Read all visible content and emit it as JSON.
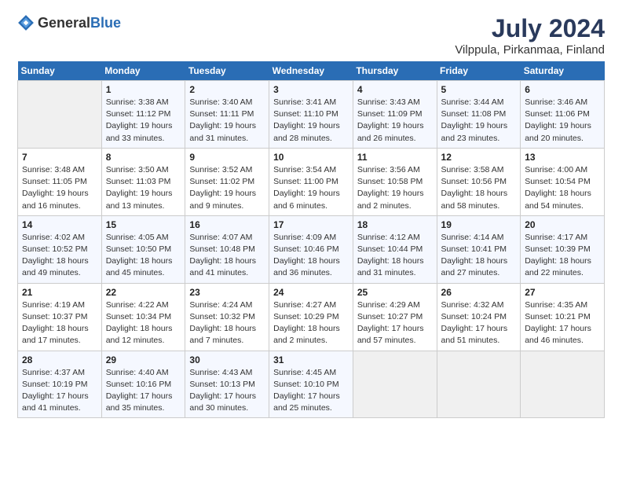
{
  "logo": {
    "general": "General",
    "blue": "Blue"
  },
  "title": "July 2024",
  "subtitle": "Vilppula, Pirkanmaa, Finland",
  "headers": [
    "Sunday",
    "Monday",
    "Tuesday",
    "Wednesday",
    "Thursday",
    "Friday",
    "Saturday"
  ],
  "weeks": [
    [
      {
        "num": "",
        "detail": ""
      },
      {
        "num": "1",
        "detail": "Sunrise: 3:38 AM\nSunset: 11:12 PM\nDaylight: 19 hours\nand 33 minutes."
      },
      {
        "num": "2",
        "detail": "Sunrise: 3:40 AM\nSunset: 11:11 PM\nDaylight: 19 hours\nand 31 minutes."
      },
      {
        "num": "3",
        "detail": "Sunrise: 3:41 AM\nSunset: 11:10 PM\nDaylight: 19 hours\nand 28 minutes."
      },
      {
        "num": "4",
        "detail": "Sunrise: 3:43 AM\nSunset: 11:09 PM\nDaylight: 19 hours\nand 26 minutes."
      },
      {
        "num": "5",
        "detail": "Sunrise: 3:44 AM\nSunset: 11:08 PM\nDaylight: 19 hours\nand 23 minutes."
      },
      {
        "num": "6",
        "detail": "Sunrise: 3:46 AM\nSunset: 11:06 PM\nDaylight: 19 hours\nand 20 minutes."
      }
    ],
    [
      {
        "num": "7",
        "detail": "Sunrise: 3:48 AM\nSunset: 11:05 PM\nDaylight: 19 hours\nand 16 minutes."
      },
      {
        "num": "8",
        "detail": "Sunrise: 3:50 AM\nSunset: 11:03 PM\nDaylight: 19 hours\nand 13 minutes."
      },
      {
        "num": "9",
        "detail": "Sunrise: 3:52 AM\nSunset: 11:02 PM\nDaylight: 19 hours\nand 9 minutes."
      },
      {
        "num": "10",
        "detail": "Sunrise: 3:54 AM\nSunset: 11:00 PM\nDaylight: 19 hours\nand 6 minutes."
      },
      {
        "num": "11",
        "detail": "Sunrise: 3:56 AM\nSunset: 10:58 PM\nDaylight: 19 hours\nand 2 minutes."
      },
      {
        "num": "12",
        "detail": "Sunrise: 3:58 AM\nSunset: 10:56 PM\nDaylight: 18 hours\nand 58 minutes."
      },
      {
        "num": "13",
        "detail": "Sunrise: 4:00 AM\nSunset: 10:54 PM\nDaylight: 18 hours\nand 54 minutes."
      }
    ],
    [
      {
        "num": "14",
        "detail": "Sunrise: 4:02 AM\nSunset: 10:52 PM\nDaylight: 18 hours\nand 49 minutes."
      },
      {
        "num": "15",
        "detail": "Sunrise: 4:05 AM\nSunset: 10:50 PM\nDaylight: 18 hours\nand 45 minutes."
      },
      {
        "num": "16",
        "detail": "Sunrise: 4:07 AM\nSunset: 10:48 PM\nDaylight: 18 hours\nand 41 minutes."
      },
      {
        "num": "17",
        "detail": "Sunrise: 4:09 AM\nSunset: 10:46 PM\nDaylight: 18 hours\nand 36 minutes."
      },
      {
        "num": "18",
        "detail": "Sunrise: 4:12 AM\nSunset: 10:44 PM\nDaylight: 18 hours\nand 31 minutes."
      },
      {
        "num": "19",
        "detail": "Sunrise: 4:14 AM\nSunset: 10:41 PM\nDaylight: 18 hours\nand 27 minutes."
      },
      {
        "num": "20",
        "detail": "Sunrise: 4:17 AM\nSunset: 10:39 PM\nDaylight: 18 hours\nand 22 minutes."
      }
    ],
    [
      {
        "num": "21",
        "detail": "Sunrise: 4:19 AM\nSunset: 10:37 PM\nDaylight: 18 hours\nand 17 minutes."
      },
      {
        "num": "22",
        "detail": "Sunrise: 4:22 AM\nSunset: 10:34 PM\nDaylight: 18 hours\nand 12 minutes."
      },
      {
        "num": "23",
        "detail": "Sunrise: 4:24 AM\nSunset: 10:32 PM\nDaylight: 18 hours\nand 7 minutes."
      },
      {
        "num": "24",
        "detail": "Sunrise: 4:27 AM\nSunset: 10:29 PM\nDaylight: 18 hours\nand 2 minutes."
      },
      {
        "num": "25",
        "detail": "Sunrise: 4:29 AM\nSunset: 10:27 PM\nDaylight: 17 hours\nand 57 minutes."
      },
      {
        "num": "26",
        "detail": "Sunrise: 4:32 AM\nSunset: 10:24 PM\nDaylight: 17 hours\nand 51 minutes."
      },
      {
        "num": "27",
        "detail": "Sunrise: 4:35 AM\nSunset: 10:21 PM\nDaylight: 17 hours\nand 46 minutes."
      }
    ],
    [
      {
        "num": "28",
        "detail": "Sunrise: 4:37 AM\nSunset: 10:19 PM\nDaylight: 17 hours\nand 41 minutes."
      },
      {
        "num": "29",
        "detail": "Sunrise: 4:40 AM\nSunset: 10:16 PM\nDaylight: 17 hours\nand 35 minutes."
      },
      {
        "num": "30",
        "detail": "Sunrise: 4:43 AM\nSunset: 10:13 PM\nDaylight: 17 hours\nand 30 minutes."
      },
      {
        "num": "31",
        "detail": "Sunrise: 4:45 AM\nSunset: 10:10 PM\nDaylight: 17 hours\nand 25 minutes."
      },
      {
        "num": "",
        "detail": ""
      },
      {
        "num": "",
        "detail": ""
      },
      {
        "num": "",
        "detail": ""
      }
    ]
  ]
}
